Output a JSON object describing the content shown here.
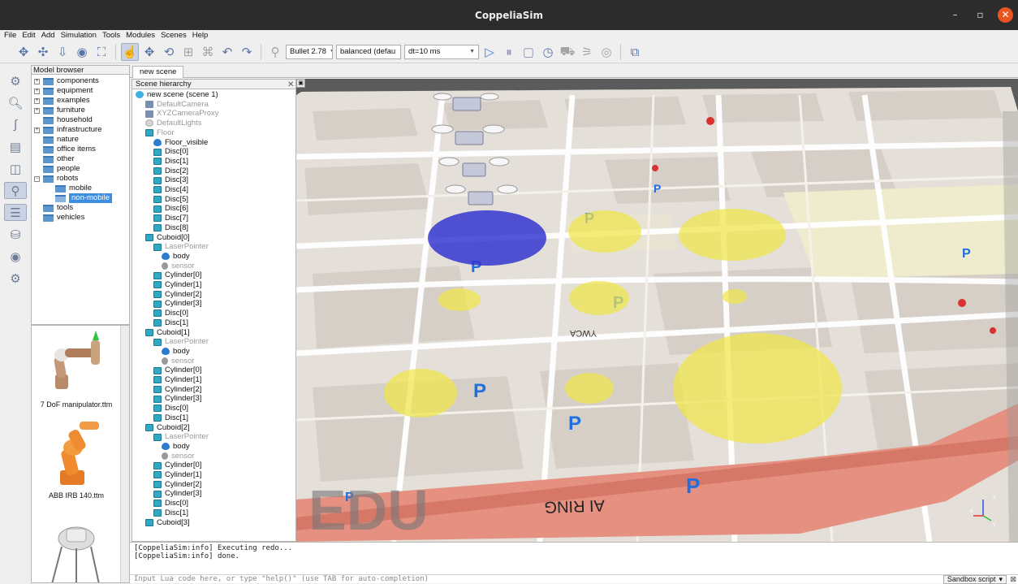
{
  "window": {
    "title": "CoppeliaSim",
    "minimize": "–",
    "maximize": "▫",
    "close": "✕"
  },
  "menu": [
    "File",
    "Edit",
    "Add",
    "Simulation",
    "Tools",
    "Modules",
    "Scenes",
    "Help"
  ],
  "toolbar": {
    "engine": "Bullet 2.78",
    "mode": "balanced (defau",
    "dt": "dt=10 ms",
    "colors": {
      "accent": "#3d8ee0",
      "icon": "#5a76a6"
    }
  },
  "model_browser": {
    "header": "Model browser",
    "items": [
      {
        "label": "components",
        "expandable": true
      },
      {
        "label": "equipment",
        "expandable": true
      },
      {
        "label": "examples",
        "expandable": true
      },
      {
        "label": "furniture",
        "expandable": true
      },
      {
        "label": "household",
        "expandable": false
      },
      {
        "label": "infrastructure",
        "expandable": true
      },
      {
        "label": "nature",
        "expandable": false
      },
      {
        "label": "office items",
        "expandable": false
      },
      {
        "label": "other",
        "expandable": false
      },
      {
        "label": "people",
        "expandable": false
      },
      {
        "label": "robots",
        "expandable": true,
        "expanded": true
      },
      {
        "label": "mobile",
        "child": true
      },
      {
        "label": "non-mobile",
        "child": true,
        "selected": true
      },
      {
        "label": "tools",
        "expandable": false
      },
      {
        "label": "vehicles",
        "expandable": false
      }
    ],
    "thumbnails": [
      "7 DoF manipulator.ttm",
      "ABB IRB 140.ttm"
    ]
  },
  "tabs": [
    "new scene"
  ],
  "scene_hierarchy": {
    "header": "Scene hierarchy",
    "items": [
      {
        "label": "new scene (scene 1)",
        "icon": "world",
        "indent": 0,
        "grey": false
      },
      {
        "label": "DefaultCamera",
        "icon": "cam",
        "indent": 1,
        "grey": true
      },
      {
        "label": "XYZCameraProxy",
        "icon": "cam",
        "indent": 1,
        "grey": true
      },
      {
        "label": "DefaultLights",
        "icon": "light",
        "indent": 1,
        "grey": true
      },
      {
        "label": "Floor",
        "icon": "cube",
        "indent": 1,
        "grey": true
      },
      {
        "label": "Floor_visible",
        "icon": "drop",
        "indent": 2,
        "grey": false
      },
      {
        "label": "Disc[0]",
        "icon": "cube",
        "indent": 2,
        "grey": false
      },
      {
        "label": "Disc[1]",
        "icon": "cube",
        "indent": 2,
        "grey": false
      },
      {
        "label": "Disc[2]",
        "icon": "cube",
        "indent": 2,
        "grey": false
      },
      {
        "label": "Disc[3]",
        "icon": "cube",
        "indent": 2,
        "grey": false
      },
      {
        "label": "Disc[4]",
        "icon": "cube",
        "indent": 2,
        "grey": false
      },
      {
        "label": "Disc[5]",
        "icon": "cube",
        "indent": 2,
        "grey": false
      },
      {
        "label": "Disc[6]",
        "icon": "cube",
        "indent": 2,
        "grey": false
      },
      {
        "label": "Disc[7]",
        "icon": "cube",
        "indent": 2,
        "grey": false
      },
      {
        "label": "Disc[8]",
        "icon": "cube",
        "indent": 2,
        "grey": false
      },
      {
        "label": "Cuboid[0]",
        "icon": "cube",
        "indent": 1,
        "grey": false
      },
      {
        "label": "LaserPointer",
        "icon": "cube",
        "indent": 2,
        "grey": true
      },
      {
        "label": "body",
        "icon": "drop",
        "indent": 3,
        "grey": false
      },
      {
        "label": "sensor",
        "icon": "sens",
        "indent": 3,
        "grey": true
      },
      {
        "label": "Cylinder[0]",
        "icon": "cube",
        "indent": 2,
        "grey": false
      },
      {
        "label": "Cylinder[1]",
        "icon": "cube",
        "indent": 2,
        "grey": false
      },
      {
        "label": "Cylinder[2]",
        "icon": "cube",
        "indent": 2,
        "grey": false
      },
      {
        "label": "Cylinder[3]",
        "icon": "cube",
        "indent": 2,
        "grey": false
      },
      {
        "label": "Disc[0]",
        "icon": "cube",
        "indent": 2,
        "grey": false
      },
      {
        "label": "Disc[1]",
        "icon": "cube",
        "indent": 2,
        "grey": false
      },
      {
        "label": "Cuboid[1]",
        "icon": "cube",
        "indent": 1,
        "grey": false
      },
      {
        "label": "LaserPointer",
        "icon": "cube",
        "indent": 2,
        "grey": true
      },
      {
        "label": "body",
        "icon": "drop",
        "indent": 3,
        "grey": false
      },
      {
        "label": "sensor",
        "icon": "sens",
        "indent": 3,
        "grey": true
      },
      {
        "label": "Cylinder[0]",
        "icon": "cube",
        "indent": 2,
        "grey": false
      },
      {
        "label": "Cylinder[1]",
        "icon": "cube",
        "indent": 2,
        "grey": false
      },
      {
        "label": "Cylinder[2]",
        "icon": "cube",
        "indent": 2,
        "grey": false
      },
      {
        "label": "Cylinder[3]",
        "icon": "cube",
        "indent": 2,
        "grey": false
      },
      {
        "label": "Disc[0]",
        "icon": "cube",
        "indent": 2,
        "grey": false
      },
      {
        "label": "Disc[1]",
        "icon": "cube",
        "indent": 2,
        "grey": false
      },
      {
        "label": "Cuboid[2]",
        "icon": "cube",
        "indent": 1,
        "grey": false
      },
      {
        "label": "LaserPointer",
        "icon": "cube",
        "indent": 2,
        "grey": true
      },
      {
        "label": "body",
        "icon": "drop",
        "indent": 3,
        "grey": false
      },
      {
        "label": "sensor",
        "icon": "sens",
        "indent": 3,
        "grey": true
      },
      {
        "label": "Cylinder[0]",
        "icon": "cube",
        "indent": 2,
        "grey": false
      },
      {
        "label": "Cylinder[1]",
        "icon": "cube",
        "indent": 2,
        "grey": false
      },
      {
        "label": "Cylinder[2]",
        "icon": "cube",
        "indent": 2,
        "grey": false
      },
      {
        "label": "Cylinder[3]",
        "icon": "cube",
        "indent": 2,
        "grey": false
      },
      {
        "label": "Disc[0]",
        "icon": "cube",
        "indent": 2,
        "grey": false
      },
      {
        "label": "Disc[1]",
        "icon": "cube",
        "indent": 2,
        "grey": false
      },
      {
        "label": "Cuboid[3]",
        "icon": "cube",
        "indent": 1,
        "grey": false
      }
    ]
  },
  "viewport": {
    "watermark": "EDU",
    "map_labels": [
      "AI RING",
      "YWCA",
      "ℓ",
      "P"
    ],
    "axis": {
      "x": "x",
      "y": "y",
      "z": "z"
    }
  },
  "console": {
    "lines": [
      "[CoppeliaSim:info] Executing redo...",
      "[CoppeliaSim:info] done."
    ],
    "input_placeholder": "Input Lua code here, or type \"help()\" (use TAB for auto-completion)",
    "script_mode": "Sandbox script"
  }
}
